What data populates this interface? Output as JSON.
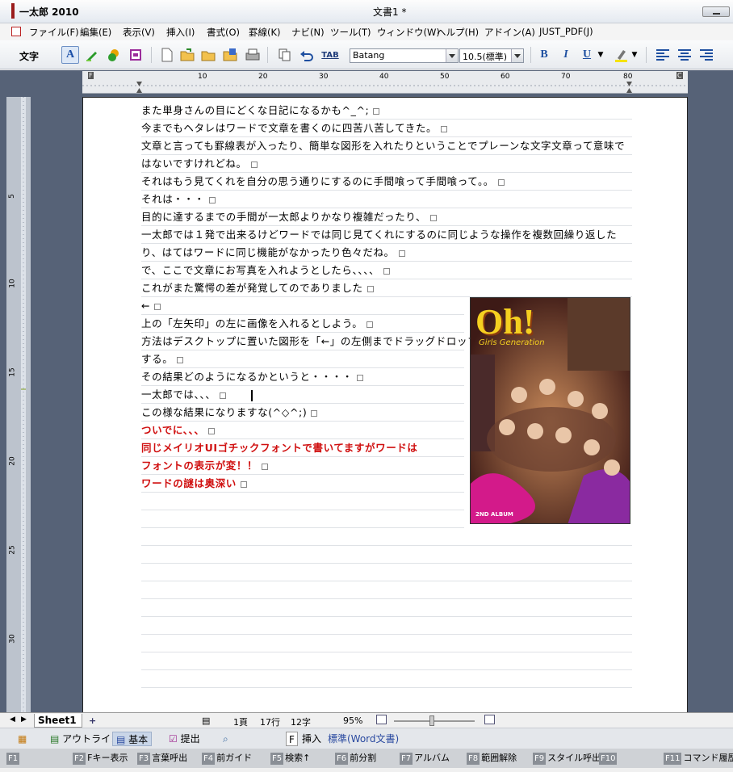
{
  "window": {
    "app_title": "一太郎 2010",
    "doc_title": "文書1 *"
  },
  "menu": [
    "ファイル(F)",
    "編集(E)",
    "表示(V)",
    "挿入(I)",
    "書式(O)",
    "罫線(K)",
    "ナビ(N)",
    "ツール(T)",
    "ウィンドウ(W)",
    "ヘルプ(H)",
    "アドイン(A)",
    "JUST_PDF(J)"
  ],
  "toolbar": {
    "mode_label": "文字",
    "tab_label": "TAB",
    "font_name": "Batang",
    "font_size": "10.5(標準)",
    "bold": "B",
    "italic": "I",
    "underline": "U"
  },
  "ruler": {
    "h_marks": [
      "10",
      "20",
      "30",
      "40",
      "50",
      "60",
      "70",
      "80"
    ],
    "v_marks": [
      "5",
      "10",
      "15",
      "20",
      "25",
      "30"
    ],
    "left_marker": "F",
    "right_marker": "C"
  },
  "document": {
    "lines": [
      {
        "text": "また単身さんの目にどくな日記になるかも^_^;",
        "red": false
      },
      {
        "text": "今までもヘタレはワードで文章を書くのに四苦八苦してきた。",
        "red": false
      },
      {
        "text": "文章と言っても罫線表が入ったり、簡単な図形を入れたりということでプレーンな文字文章って意味で",
        "red": false,
        "noret": true
      },
      {
        "text": "はないですけれどね。",
        "red": false
      },
      {
        "text": "それはもう見てくれを自分の思う通りにするのに手間喰って手間喰って。。",
        "red": false
      },
      {
        "text": "それは・・・",
        "red": false
      },
      {
        "text": "目的に達するまでの手間が一太郎よりかなり複雑だったり、",
        "red": false
      },
      {
        "text": "一太郎では１発で出来るけどワードでは同じ見てくれにするのに同じような操作を複数回繰り返した",
        "red": false,
        "noret": true
      },
      {
        "text": "り、はてはワードに同じ機能がなかったり色々だね。",
        "red": false
      },
      {
        "text": "で、ここで文章にお写真を入れようとしたら、、、、",
        "red": false
      },
      {
        "text": "これがまた驚愕の差が発覚してのでありました",
        "red": false
      },
      {
        "text": "←",
        "red": false
      },
      {
        "text": "上の「左矢印」の左に画像を入れるとしよう。",
        "red": false
      },
      {
        "text": "方法はデスクトップに置いた図形を「←」の左側までドラッグドロップ",
        "red": false,
        "noret": true
      },
      {
        "text": "する。",
        "red": false
      },
      {
        "text": "その結果どのようになるかというと・・・・",
        "red": false
      },
      {
        "text": "一太郎では、、、",
        "red": false
      },
      {
        "text": "この様な結果になりますな(^◇^;)",
        "red": false
      },
      {
        "text": "ついでに、、、",
        "red": true
      },
      {
        "text": "同じメイリオUIゴチックフォントで書いてますがワードは",
        "red": true,
        "noret": true
      },
      {
        "text": "フォントの表示が変！！",
        "red": true
      },
      {
        "text": "ワードの謎は奥深い",
        "red": true
      }
    ]
  },
  "image": {
    "title": "Oh!",
    "subtitle": "Girls Generation",
    "footer": "2ND ALBUM"
  },
  "status": {
    "sheet": "Sheet1",
    "add": "+",
    "page": "1頁",
    "row": "17行",
    "col": "12字",
    "zoom": "95%"
  },
  "modes": {
    "outline": "アウトライン",
    "basic": "基本",
    "submit": "提出",
    "insert_key": "F",
    "insert": "挿入",
    "std_word": "標準(Word文書)"
  },
  "fkeys": [
    {
      "n": "F1",
      "l": ""
    },
    {
      "n": "F2",
      "l": "Fキー表示"
    },
    {
      "n": "F3",
      "l": "言葉呼出"
    },
    {
      "n": "F4",
      "l": "前ガイド"
    },
    {
      "n": "F5",
      "l": "検索↑"
    },
    {
      "n": "F6",
      "l": "前分割"
    },
    {
      "n": "F7",
      "l": "アルバム"
    },
    {
      "n": "F8",
      "l": "範囲解除"
    },
    {
      "n": "F9",
      "l": "スタイル呼出"
    },
    {
      "n": "F10",
      "l": ""
    },
    {
      "n": "F11",
      "l": "コマンド履歴"
    }
  ]
}
